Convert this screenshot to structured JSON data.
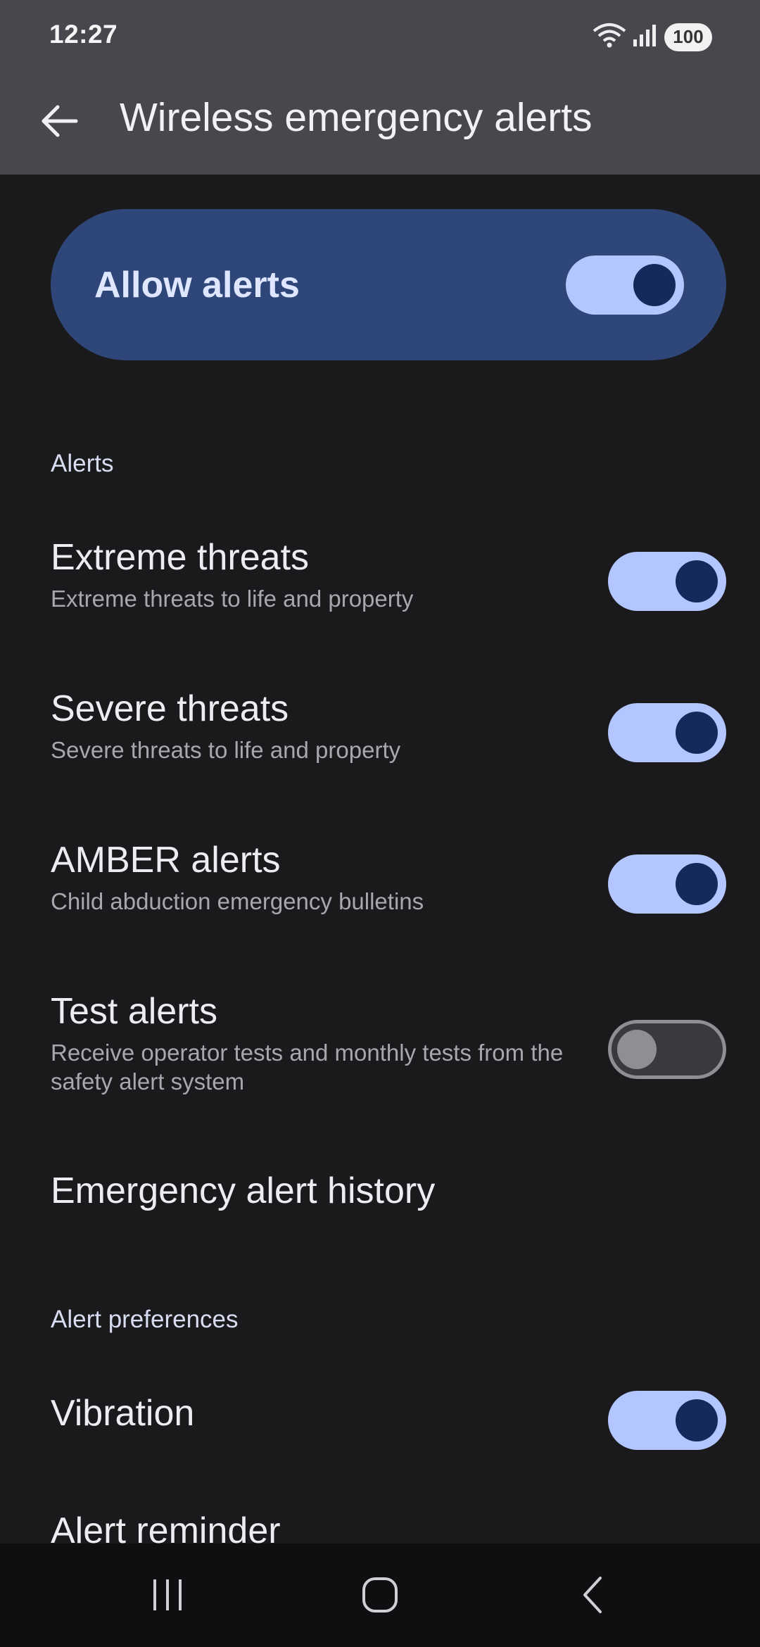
{
  "status_bar": {
    "time": "12:27",
    "battery": "100",
    "icons": [
      "wifi-icon",
      "signal-icon",
      "battery-icon"
    ]
  },
  "app_bar": {
    "back_icon": "arrow-left-icon",
    "title": "Wireless emergency alerts"
  },
  "master": {
    "label": "Allow alerts",
    "enabled": true
  },
  "sections": {
    "alerts": "Alerts",
    "preferences": "Alert preferences"
  },
  "alerts": [
    {
      "title": "Extreme threats",
      "subtitle": "Extreme threats to life and property",
      "enabled": true
    },
    {
      "title": "Severe threats",
      "subtitle": "Severe threats to life and property",
      "enabled": true
    },
    {
      "title": "AMBER alerts",
      "subtitle": "Child abduction emergency bulletins",
      "enabled": true
    },
    {
      "title": "Test alerts",
      "subtitle": "Receive operator tests and monthly tests from the safety alert system",
      "enabled": false
    }
  ],
  "history": {
    "title": "Emergency alert history"
  },
  "preferences": [
    {
      "title": "Vibration",
      "enabled": true
    },
    {
      "title": "Alert reminder"
    }
  ],
  "nav_bar": {
    "icons": [
      "recents-icon",
      "home-icon",
      "back-icon"
    ]
  },
  "colors": {
    "accent_track": "#b3c6ff",
    "accent_knob": "#142a5a",
    "card_bg": "#2f4778",
    "background": "#1a1a1c"
  }
}
